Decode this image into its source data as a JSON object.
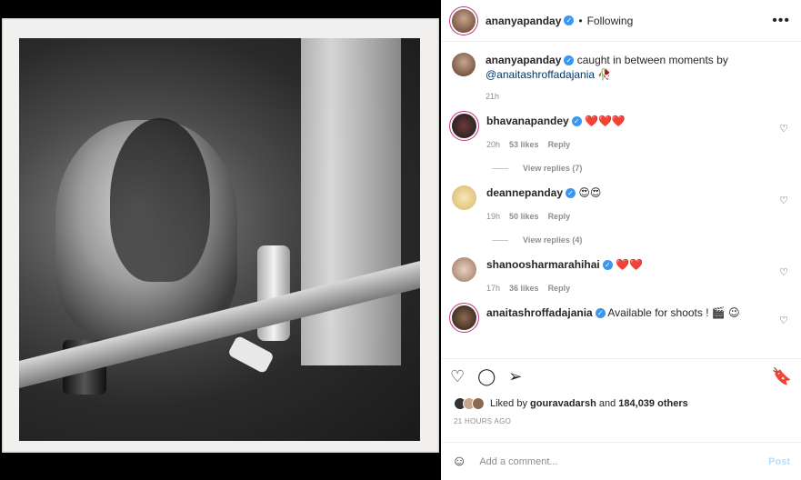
{
  "post": {
    "author": "ananyapanday",
    "follow_sep": "•",
    "follow_label": "Following",
    "more": "•••"
  },
  "caption": {
    "username": "ananyapanday",
    "text": "caught in between moments by",
    "mention": "@anaitashroffadajania",
    "emoji": "🥀",
    "time": "21h"
  },
  "comments": [
    {
      "username": "bhavanapandey",
      "text": "❤️❤️❤️",
      "time": "20h",
      "likes": "53 likes",
      "reply": "Reply",
      "view_replies": "View replies (7)"
    },
    {
      "username": "deannepanday",
      "text": "😍😍",
      "time": "19h",
      "likes": "50 likes",
      "reply": "Reply",
      "view_replies": "View replies (4)"
    },
    {
      "username": "shanoosharmarahihai",
      "text": "❤️❤️",
      "time": "17h",
      "likes": "36 likes",
      "reply": "Reply"
    },
    {
      "username": "anaitashroffadajania",
      "text": "Available for shoots ! 🎬 😉"
    }
  ],
  "likes": {
    "prefix": "Liked by",
    "user": "gouravadarsh",
    "and": "and",
    "count": "184,039 others"
  },
  "posted_ago": "21 HOURS AGO",
  "add_comment": {
    "placeholder": "Add a comment...",
    "post_label": "Post"
  },
  "icons": {
    "verified": "✓",
    "heart_small": "♡",
    "like": "♡",
    "comment": "◯",
    "share": "➢",
    "save": "🔖",
    "emoji": "☺"
  }
}
